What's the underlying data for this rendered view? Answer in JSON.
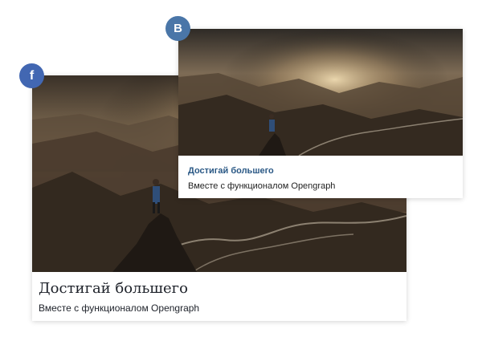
{
  "facebook_preview": {
    "badge_letter": "f",
    "badge_icon": "facebook-icon",
    "badge_color": "#4267b2",
    "title": "Достигай большего",
    "description": "Вместе с функционалом Opengraph",
    "image_icon": "mountain-landscape-image"
  },
  "vk_preview": {
    "badge_letter": "В",
    "badge_icon": "vk-icon",
    "badge_color": "#4a76a8",
    "title": "Достигай большего",
    "title_color": "#2a5885",
    "description": "Вместе с функционалом Opengraph",
    "image_icon": "mountain-landscape-image"
  }
}
